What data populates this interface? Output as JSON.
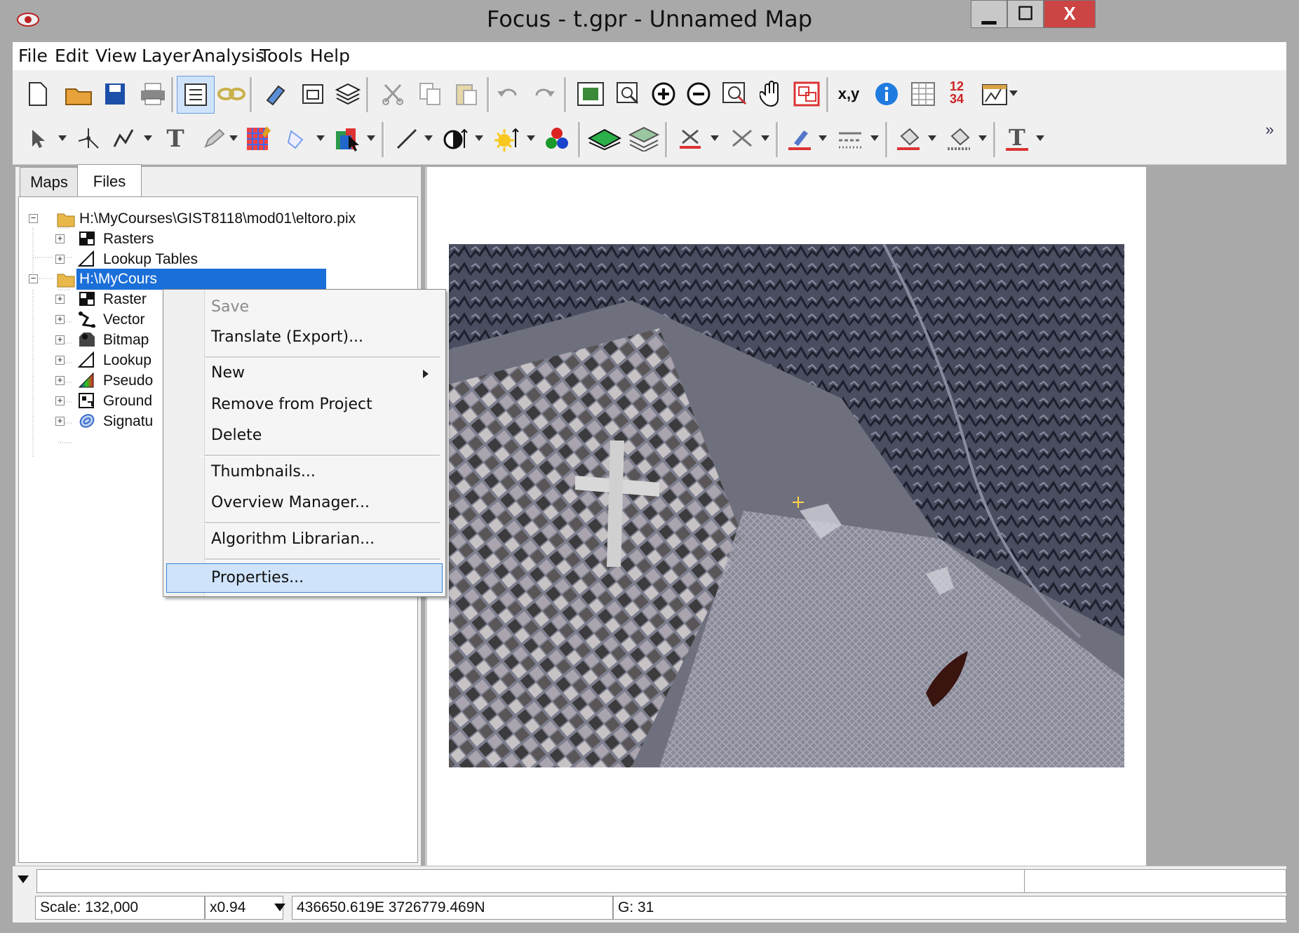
{
  "window": {
    "title": "Focus - t.gpr - Unnamed Map",
    "minimize": "▁",
    "maximize": "☐",
    "close": "X"
  },
  "menu": [
    "File",
    "Edit",
    "View",
    "Layer",
    "Analysis",
    "Tools",
    "Help"
  ],
  "toolbar": {
    "coord_icon_label": "x,y",
    "numbers_icon_label": "12 34",
    "overflow": "»"
  },
  "tabs": {
    "maps": "Maps",
    "files": "Files"
  },
  "tree": {
    "file1": {
      "label": "H:\\MyCourses\\GIST8118\\mod01\\eltoro.pix",
      "children": [
        "Rasters",
        "Lookup Tables"
      ]
    },
    "file2": {
      "label": "H:\\MyCours",
      "children": [
        "Raster",
        "Vector",
        "Bitmap",
        "Lookup",
        "Pseudo",
        "Ground",
        "Signatu"
      ]
    }
  },
  "context_menu": {
    "save": "Save",
    "translate": "Translate (Export)...",
    "new": "New",
    "remove": "Remove from Project",
    "delete": "Delete",
    "thumbnails": "Thumbnails...",
    "overview": "Overview Manager...",
    "algorithm": "Algorithm Librarian...",
    "properties": "Properties..."
  },
  "status": {
    "scale": "Scale: 132,000",
    "zoom": "x0.94",
    "coords": "436650.619E 3726779.469N",
    "value": "G: 31"
  }
}
